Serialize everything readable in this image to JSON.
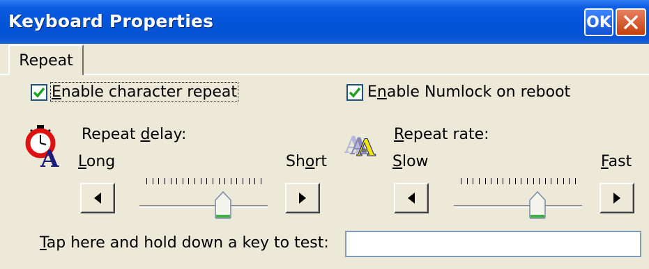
{
  "window": {
    "title": "Keyboard Properties",
    "ok_label": "OK",
    "close_icon": "close-icon"
  },
  "tabs": [
    {
      "label": "Repeat",
      "selected": true
    }
  ],
  "repeat": {
    "enable_repeat": {
      "label": "Enable character repeat",
      "checked": true
    },
    "enable_numlock": {
      "label": "Enable Numlock on reboot",
      "checked": true
    },
    "delay": {
      "icon": "stopwatch-a-icon",
      "label": "Repeat delay:",
      "min_label": "Long",
      "max_label": "Short",
      "value": 0.67
    },
    "rate": {
      "icon": "repeated-a-icon",
      "label": "Repeat rate:",
      "min_label": "Slow",
      "max_label": "Fast",
      "value": 0.67
    },
    "test": {
      "label": "Tap here and hold down a key to test:",
      "value": ""
    }
  },
  "colors": {
    "titlebar": "#0454d8",
    "background": "#ece9d8",
    "check": "#21a121",
    "thumb_green": "#3cb043"
  }
}
